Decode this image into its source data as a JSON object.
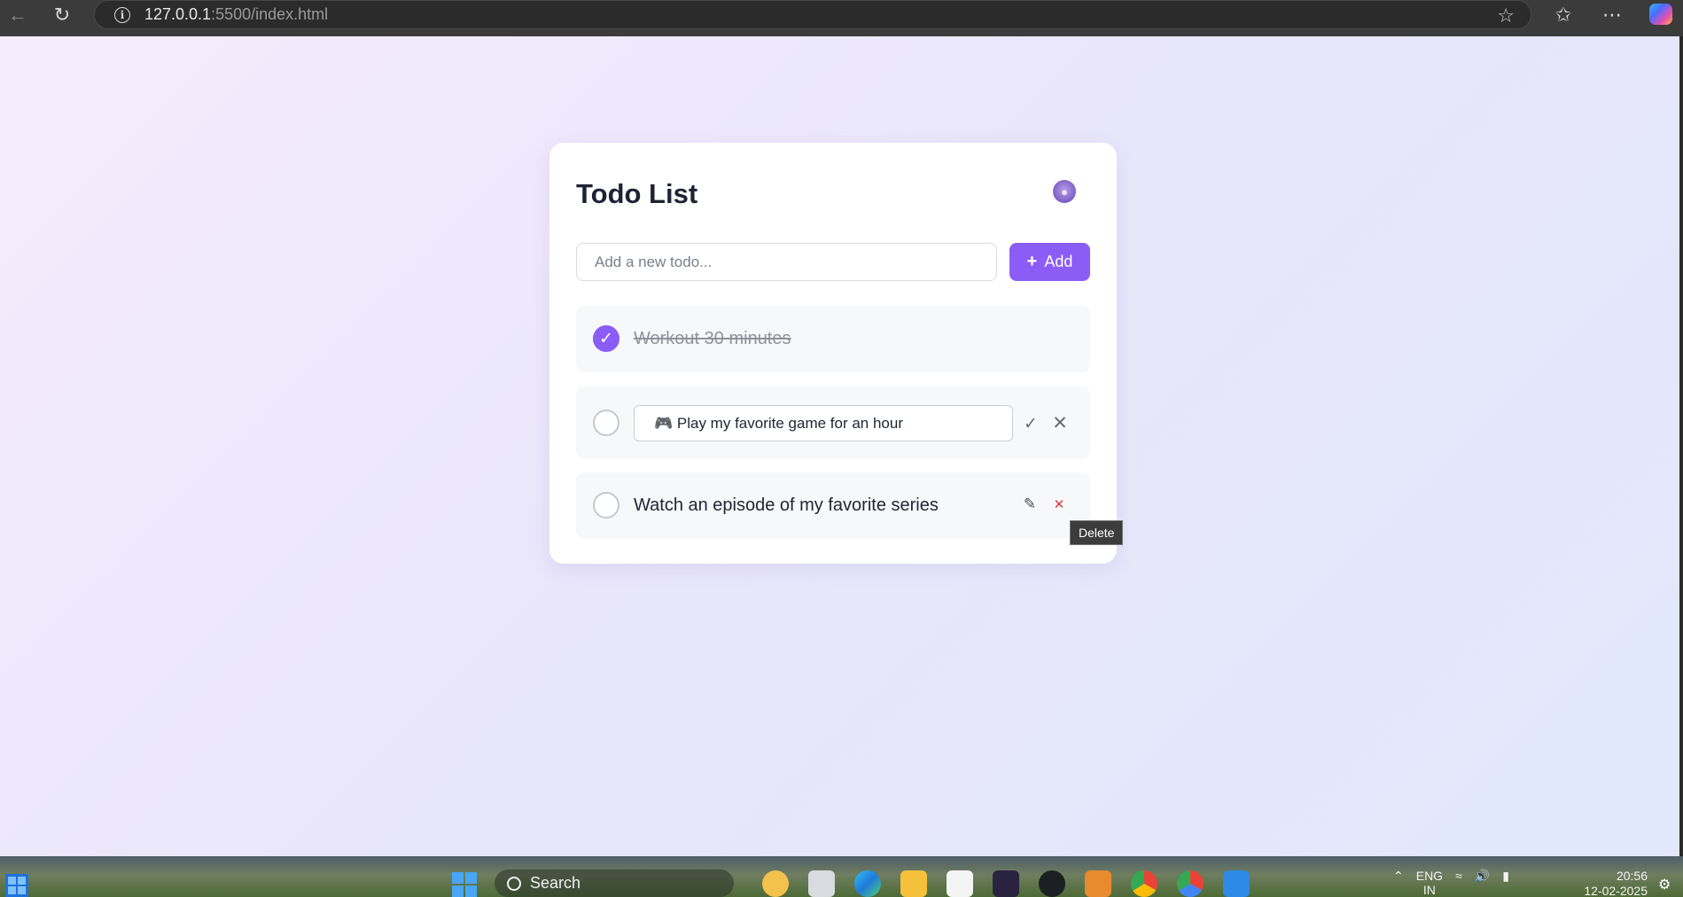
{
  "browser": {
    "url_host": "127.0.0.1",
    "url_rest": ":5500/index.html"
  },
  "app": {
    "title": "Todo List",
    "input_placeholder": "Add a new todo...",
    "add_label": "Add",
    "todos": [
      {
        "text": "Workout 30 minutes",
        "done": true,
        "state": "completed"
      },
      {
        "text": "🎮 Play my favorite game for an hour",
        "done": false,
        "state": "editing"
      },
      {
        "text": "Watch an episode of my favorite series",
        "done": false,
        "state": "normal"
      }
    ],
    "tooltip": "Delete",
    "accent_color": "#8b5cf6"
  },
  "taskbar": {
    "search_label": "Search",
    "lang_line1": "ENG",
    "lang_line2": "IN",
    "time": "20:56",
    "date": "12-02-2025"
  }
}
